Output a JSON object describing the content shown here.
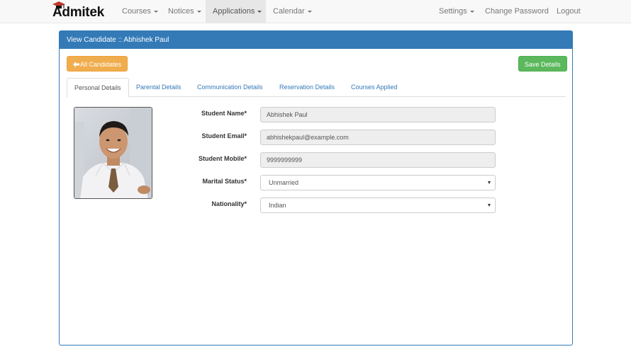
{
  "brand": {
    "name": "Admitek"
  },
  "nav": {
    "left": [
      {
        "label": "Courses",
        "dropdown": true
      },
      {
        "label": "Notices",
        "dropdown": true
      },
      {
        "label": "Applications",
        "dropdown": true,
        "active": true
      },
      {
        "label": "Calendar",
        "dropdown": true
      }
    ],
    "right": [
      {
        "label": "Settings",
        "dropdown": true
      },
      {
        "label": "Change Password"
      },
      {
        "label": "Logout"
      }
    ]
  },
  "panel": {
    "title": "View Candidate :: Abhishek Paul"
  },
  "actions": {
    "back_label": "All Candidates",
    "back_icon": "arrow-left-icon",
    "save_label": "Save Details"
  },
  "tabs": [
    {
      "label": "Personal Details",
      "active": true
    },
    {
      "label": "Parental Details"
    },
    {
      "label": "Communication Details"
    },
    {
      "label": "Reservation Details"
    },
    {
      "label": "Courses Applied"
    }
  ],
  "form": {
    "student_name": {
      "label": "Student Name*",
      "value": "Abhishek Paul"
    },
    "student_email": {
      "label": "Student Email*",
      "value": "abhishekpaul@example.com"
    },
    "student_mobile": {
      "label": "Student Mobile*",
      "value": "9999999999"
    },
    "marital_status": {
      "label": "Marital Status*",
      "value": "Unmarried"
    },
    "nationality": {
      "label": "Nationality*",
      "value": "Indian"
    }
  },
  "colors": {
    "primary": "#337ab7",
    "warning": "#f0ad4e",
    "success": "#5cb85c",
    "navbar_bg": "#f8f8f8"
  }
}
